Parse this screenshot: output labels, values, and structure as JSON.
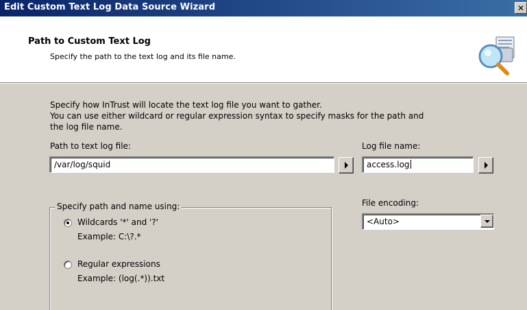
{
  "window": {
    "title": "Edit Custom Text Log Data Source Wizard",
    "close_symbol": "✕"
  },
  "header": {
    "title": "Path to Custom Text Log",
    "subtitle": "Specify the path to the text log and its file name.",
    "icon": "log-file-search-icon"
  },
  "intro": {
    "line1": "Specify how InTrust will locate the text log file you want to gather.",
    "line2": "You can use either wildcard or regular expression syntax to specify masks for the path and",
    "line3": "the log file name."
  },
  "path_field": {
    "label": "Path to text log file:",
    "value": "/var/log/squid"
  },
  "name_field": {
    "label": "Log file name:",
    "value": "access.log"
  },
  "syntax_group": {
    "legend": "Specify path and name using:",
    "options": [
      {
        "label": "Wildcards '*' and '?'",
        "example": "Example: C:\\?.*",
        "selected": true
      },
      {
        "label": "Regular expressions",
        "example": "Example: (log(.*)).txt",
        "selected": false
      }
    ]
  },
  "encoding": {
    "label": "File encoding:",
    "value": "<Auto>"
  },
  "colors": {
    "dialog_face": "#d4d0c8",
    "title_bar_start": "#0a246a",
    "title_bar_end": "#3a6ea5"
  }
}
